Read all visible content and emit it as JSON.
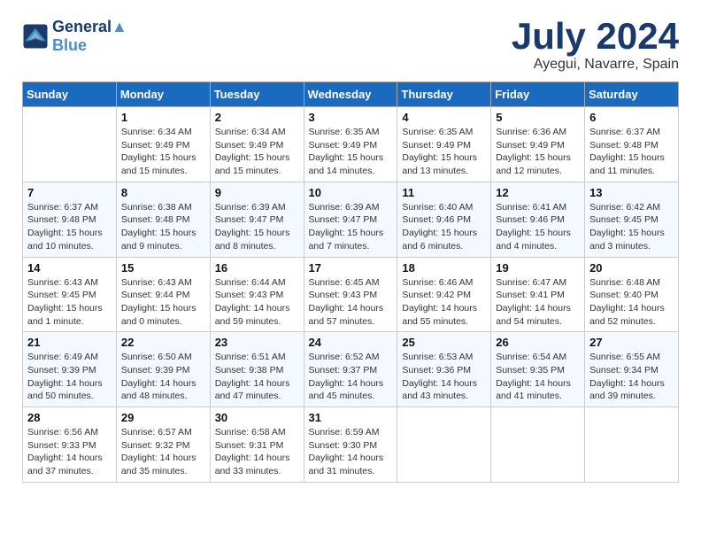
{
  "header": {
    "logo_line1": "General",
    "logo_line2": "Blue",
    "month": "July 2024",
    "location": "Ayegui, Navarre, Spain"
  },
  "weekdays": [
    "Sunday",
    "Monday",
    "Tuesday",
    "Wednesday",
    "Thursday",
    "Friday",
    "Saturday"
  ],
  "weeks": [
    [
      {
        "day": "",
        "info": ""
      },
      {
        "day": "1",
        "info": "Sunrise: 6:34 AM\nSunset: 9:49 PM\nDaylight: 15 hours\nand 15 minutes."
      },
      {
        "day": "2",
        "info": "Sunrise: 6:34 AM\nSunset: 9:49 PM\nDaylight: 15 hours\nand 15 minutes."
      },
      {
        "day": "3",
        "info": "Sunrise: 6:35 AM\nSunset: 9:49 PM\nDaylight: 15 hours\nand 14 minutes."
      },
      {
        "day": "4",
        "info": "Sunrise: 6:35 AM\nSunset: 9:49 PM\nDaylight: 15 hours\nand 13 minutes."
      },
      {
        "day": "5",
        "info": "Sunrise: 6:36 AM\nSunset: 9:49 PM\nDaylight: 15 hours\nand 12 minutes."
      },
      {
        "day": "6",
        "info": "Sunrise: 6:37 AM\nSunset: 9:48 PM\nDaylight: 15 hours\nand 11 minutes."
      }
    ],
    [
      {
        "day": "7",
        "info": "Sunrise: 6:37 AM\nSunset: 9:48 PM\nDaylight: 15 hours\nand 10 minutes."
      },
      {
        "day": "8",
        "info": "Sunrise: 6:38 AM\nSunset: 9:48 PM\nDaylight: 15 hours\nand 9 minutes."
      },
      {
        "day": "9",
        "info": "Sunrise: 6:39 AM\nSunset: 9:47 PM\nDaylight: 15 hours\nand 8 minutes."
      },
      {
        "day": "10",
        "info": "Sunrise: 6:39 AM\nSunset: 9:47 PM\nDaylight: 15 hours\nand 7 minutes."
      },
      {
        "day": "11",
        "info": "Sunrise: 6:40 AM\nSunset: 9:46 PM\nDaylight: 15 hours\nand 6 minutes."
      },
      {
        "day": "12",
        "info": "Sunrise: 6:41 AM\nSunset: 9:46 PM\nDaylight: 15 hours\nand 4 minutes."
      },
      {
        "day": "13",
        "info": "Sunrise: 6:42 AM\nSunset: 9:45 PM\nDaylight: 15 hours\nand 3 minutes."
      }
    ],
    [
      {
        "day": "14",
        "info": "Sunrise: 6:43 AM\nSunset: 9:45 PM\nDaylight: 15 hours\nand 1 minute."
      },
      {
        "day": "15",
        "info": "Sunrise: 6:43 AM\nSunset: 9:44 PM\nDaylight: 15 hours\nand 0 minutes."
      },
      {
        "day": "16",
        "info": "Sunrise: 6:44 AM\nSunset: 9:43 PM\nDaylight: 14 hours\nand 59 minutes."
      },
      {
        "day": "17",
        "info": "Sunrise: 6:45 AM\nSunset: 9:43 PM\nDaylight: 14 hours\nand 57 minutes."
      },
      {
        "day": "18",
        "info": "Sunrise: 6:46 AM\nSunset: 9:42 PM\nDaylight: 14 hours\nand 55 minutes."
      },
      {
        "day": "19",
        "info": "Sunrise: 6:47 AM\nSunset: 9:41 PM\nDaylight: 14 hours\nand 54 minutes."
      },
      {
        "day": "20",
        "info": "Sunrise: 6:48 AM\nSunset: 9:40 PM\nDaylight: 14 hours\nand 52 minutes."
      }
    ],
    [
      {
        "day": "21",
        "info": "Sunrise: 6:49 AM\nSunset: 9:39 PM\nDaylight: 14 hours\nand 50 minutes."
      },
      {
        "day": "22",
        "info": "Sunrise: 6:50 AM\nSunset: 9:39 PM\nDaylight: 14 hours\nand 48 minutes."
      },
      {
        "day": "23",
        "info": "Sunrise: 6:51 AM\nSunset: 9:38 PM\nDaylight: 14 hours\nand 47 minutes."
      },
      {
        "day": "24",
        "info": "Sunrise: 6:52 AM\nSunset: 9:37 PM\nDaylight: 14 hours\nand 45 minutes."
      },
      {
        "day": "25",
        "info": "Sunrise: 6:53 AM\nSunset: 9:36 PM\nDaylight: 14 hours\nand 43 minutes."
      },
      {
        "day": "26",
        "info": "Sunrise: 6:54 AM\nSunset: 9:35 PM\nDaylight: 14 hours\nand 41 minutes."
      },
      {
        "day": "27",
        "info": "Sunrise: 6:55 AM\nSunset: 9:34 PM\nDaylight: 14 hours\nand 39 minutes."
      }
    ],
    [
      {
        "day": "28",
        "info": "Sunrise: 6:56 AM\nSunset: 9:33 PM\nDaylight: 14 hours\nand 37 minutes."
      },
      {
        "day": "29",
        "info": "Sunrise: 6:57 AM\nSunset: 9:32 PM\nDaylight: 14 hours\nand 35 minutes."
      },
      {
        "day": "30",
        "info": "Sunrise: 6:58 AM\nSunset: 9:31 PM\nDaylight: 14 hours\nand 33 minutes."
      },
      {
        "day": "31",
        "info": "Sunrise: 6:59 AM\nSunset: 9:30 PM\nDaylight: 14 hours\nand 31 minutes."
      },
      {
        "day": "",
        "info": ""
      },
      {
        "day": "",
        "info": ""
      },
      {
        "day": "",
        "info": ""
      }
    ]
  ]
}
